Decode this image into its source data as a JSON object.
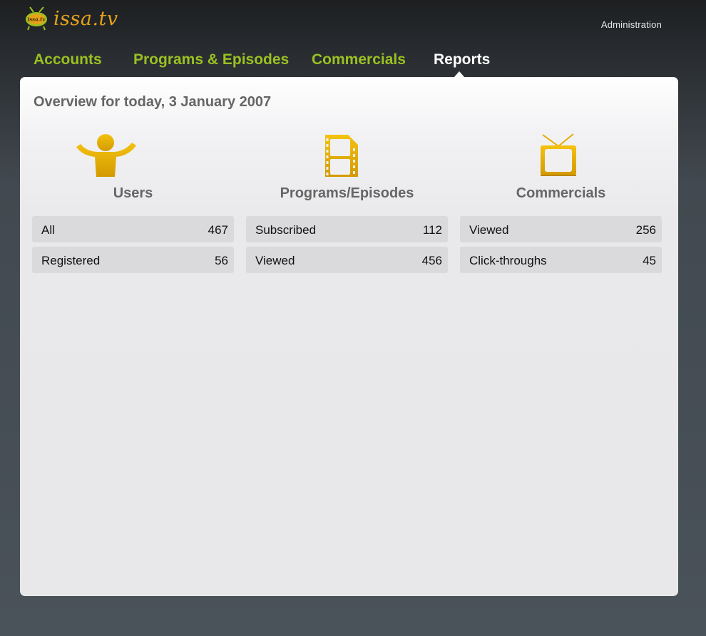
{
  "header": {
    "logo_text": "issa.tv",
    "logo_badge": "issa.tv",
    "admin_link": "Administration"
  },
  "nav": {
    "tabs": [
      {
        "label": "Accounts",
        "active": false
      },
      {
        "label": "Programs & Episodes",
        "active": false
      },
      {
        "label": "Commercials",
        "active": false
      },
      {
        "label": "Reports",
        "active": true
      }
    ]
  },
  "overview": {
    "title": "Overview for today, 3 January 2007",
    "columns": [
      {
        "heading": "Users",
        "icon": "user-icon",
        "stats": [
          {
            "label": "All",
            "value": "467"
          },
          {
            "label": "Registered",
            "value": "56"
          }
        ]
      },
      {
        "heading": "Programs/Episodes",
        "icon": "film-icon",
        "stats": [
          {
            "label": "Subscribed",
            "value": "112"
          },
          {
            "label": "Viewed",
            "value": "456"
          }
        ]
      },
      {
        "heading": "Commercials",
        "icon": "tv-icon",
        "stats": [
          {
            "label": "Viewed",
            "value": "256"
          },
          {
            "label": "Click-throughs",
            "value": "45"
          }
        ]
      }
    ]
  },
  "colors": {
    "nav_tab": "#9ac122",
    "nav_active": "#ffffff",
    "icon_gold": "#e3ad07",
    "heading_gray": "#666666",
    "logo_orange": "#e6a21a"
  }
}
